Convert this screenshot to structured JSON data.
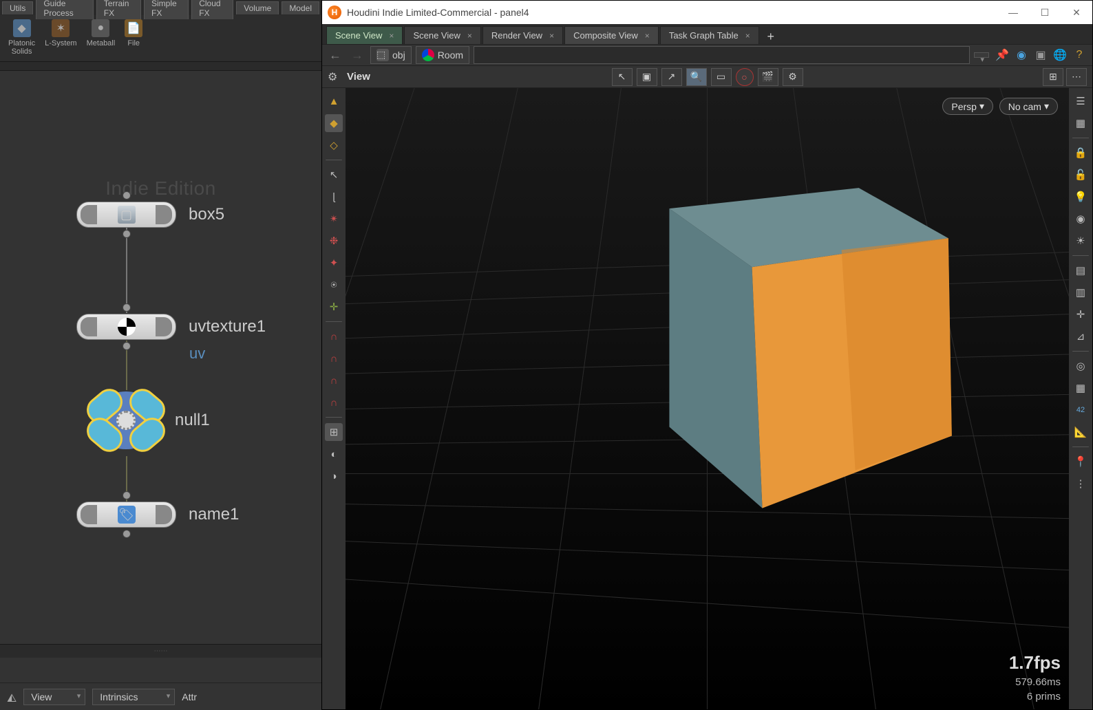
{
  "shelf_tabs": [
    "Utils",
    "Guide Process",
    "Terrain FX",
    "Simple FX",
    "Cloud FX",
    "Volume",
    "Model"
  ],
  "shelf_items": [
    {
      "label": "Platonic\nSolids",
      "color": "#7aa3d0"
    },
    {
      "label": "L-System",
      "color": "#c48a3a"
    },
    {
      "label": "Metaball",
      "color": "#a0a0c0"
    },
    {
      "label": "File",
      "color": "#d0a050"
    }
  ],
  "watermark": "Indie Edition",
  "nodes": {
    "box": {
      "label": "box5"
    },
    "uv": {
      "label": "uvtexture1",
      "attr": "uv"
    },
    "null": {
      "label": "null1"
    },
    "name": {
      "label": "name1"
    }
  },
  "bottom": {
    "view": "View",
    "intr": "Intrinsics",
    "attr": "Attr"
  },
  "window": {
    "title": "Houdini Indie Limited-Commercial - panel4",
    "tabs": [
      {
        "label": "Scene View",
        "active": true
      },
      {
        "label": "Scene View"
      },
      {
        "label": "Render View"
      },
      {
        "label": "Composite View",
        "sub": true
      },
      {
        "label": "Task Graph Table"
      }
    ],
    "path": {
      "root": "obj",
      "node": "Room"
    },
    "view_label": "View",
    "badges": {
      "persp": "Persp",
      "cam": "No cam"
    },
    "stats": {
      "fps": "1.7fps",
      "ms": "579.66ms",
      "prims": "6  prims"
    }
  }
}
